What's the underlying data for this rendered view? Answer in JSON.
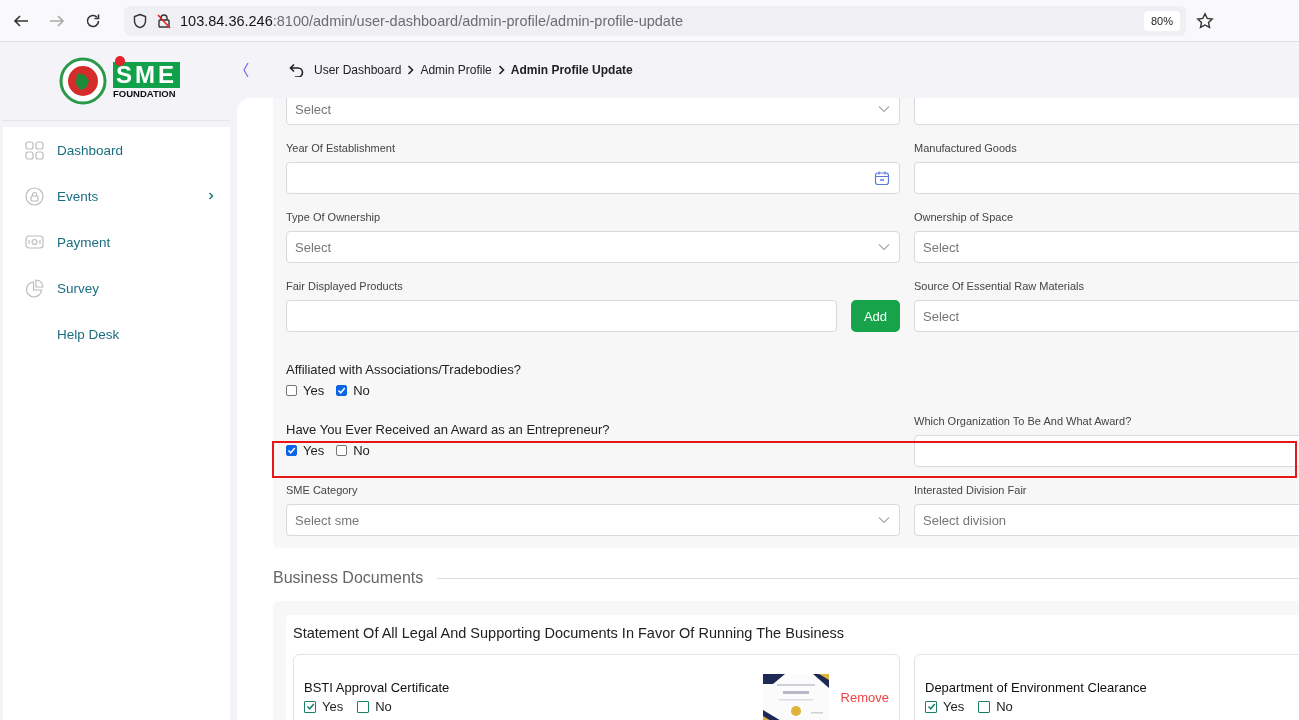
{
  "browser": {
    "url_host": "103.84.36.246",
    "url_path": ":8100/admin/user-dashboard/admin-profile/admin-profile-update",
    "zoom": "80%"
  },
  "logo": {
    "text": "SME",
    "subtext": "FOUNDATION"
  },
  "sidebar": {
    "items": [
      {
        "label": "Dashboard",
        "has_icon": true,
        "has_submenu": false
      },
      {
        "label": "Events",
        "has_icon": true,
        "has_submenu": true
      },
      {
        "label": "Payment",
        "has_icon": true,
        "has_submenu": false
      },
      {
        "label": "Survey",
        "has_icon": true,
        "has_submenu": false
      },
      {
        "label": "Help Desk",
        "has_icon": false,
        "has_submenu": false
      }
    ]
  },
  "breadcrumb": [
    {
      "label": "User Dashboard",
      "current": false
    },
    {
      "label": "Admin Profile",
      "current": false
    },
    {
      "label": "Admin Profile Update",
      "current": true
    }
  ],
  "form": {
    "rows": [
      {
        "highlighted": false,
        "cells": [
          {
            "kind": "select",
            "placeholder": "Select"
          },
          {
            "kind": "input"
          }
        ]
      },
      {
        "highlighted": false,
        "cells": [
          {
            "kind": "date",
            "label": "Year Of Establishment"
          },
          {
            "kind": "input",
            "label": "Manufactured Goods"
          }
        ]
      },
      {
        "highlighted": false,
        "cells": [
          {
            "kind": "select",
            "label": "Type Of Ownership",
            "placeholder": "Select"
          },
          {
            "kind": "select",
            "label": "Ownership of Space",
            "placeholder": "Select"
          }
        ]
      },
      {
        "highlighted": false,
        "cells": [
          {
            "kind": "input_add",
            "label": "Fair Displayed Products",
            "button": "Add"
          },
          {
            "kind": "select",
            "label": "Source Of Essential Raw Materials",
            "placeholder": "Select"
          }
        ]
      },
      {
        "highlighted": false,
        "cells": [
          {
            "kind": "checks",
            "question": "Affiliated with Associations/Tradebodies?",
            "options": [
              {
                "label": "Yes",
                "checked": false
              },
              {
                "label": "No",
                "checked": true
              }
            ]
          }
        ]
      },
      {
        "highlighted": true,
        "cells": [
          {
            "kind": "checks",
            "question": "Have You Ever Received an Award as an Entrepreneur?",
            "options": [
              {
                "label": "Yes",
                "checked": true
              },
              {
                "label": "No",
                "checked": false
              }
            ]
          },
          {
            "kind": "input",
            "label": "Which Organization To Be And What Award?"
          }
        ]
      },
      {
        "highlighted": false,
        "cells": [
          {
            "kind": "select",
            "label": "SME Category",
            "placeholder": "Select sme"
          },
          {
            "kind": "select",
            "label": "Interasted Division Fair",
            "placeholder": "Select division"
          }
        ]
      }
    ]
  },
  "business_documents": {
    "heading": "Business Documents",
    "title": "Statement Of All Legal And Supporting Documents In Favor Of Running The Business",
    "documents": [
      {
        "name": "BSTI Approval Certificate",
        "options": [
          {
            "label": "Yes",
            "checked": true
          },
          {
            "label": "No",
            "checked": false
          }
        ],
        "attachment": {
          "kind": "picture"
        },
        "remove": "Remove"
      },
      {
        "name": "Department of Environment Clearance",
        "options": [
          {
            "label": "Yes",
            "checked": true
          },
          {
            "label": "No",
            "checked": false
          }
        ]
      }
    ]
  }
}
